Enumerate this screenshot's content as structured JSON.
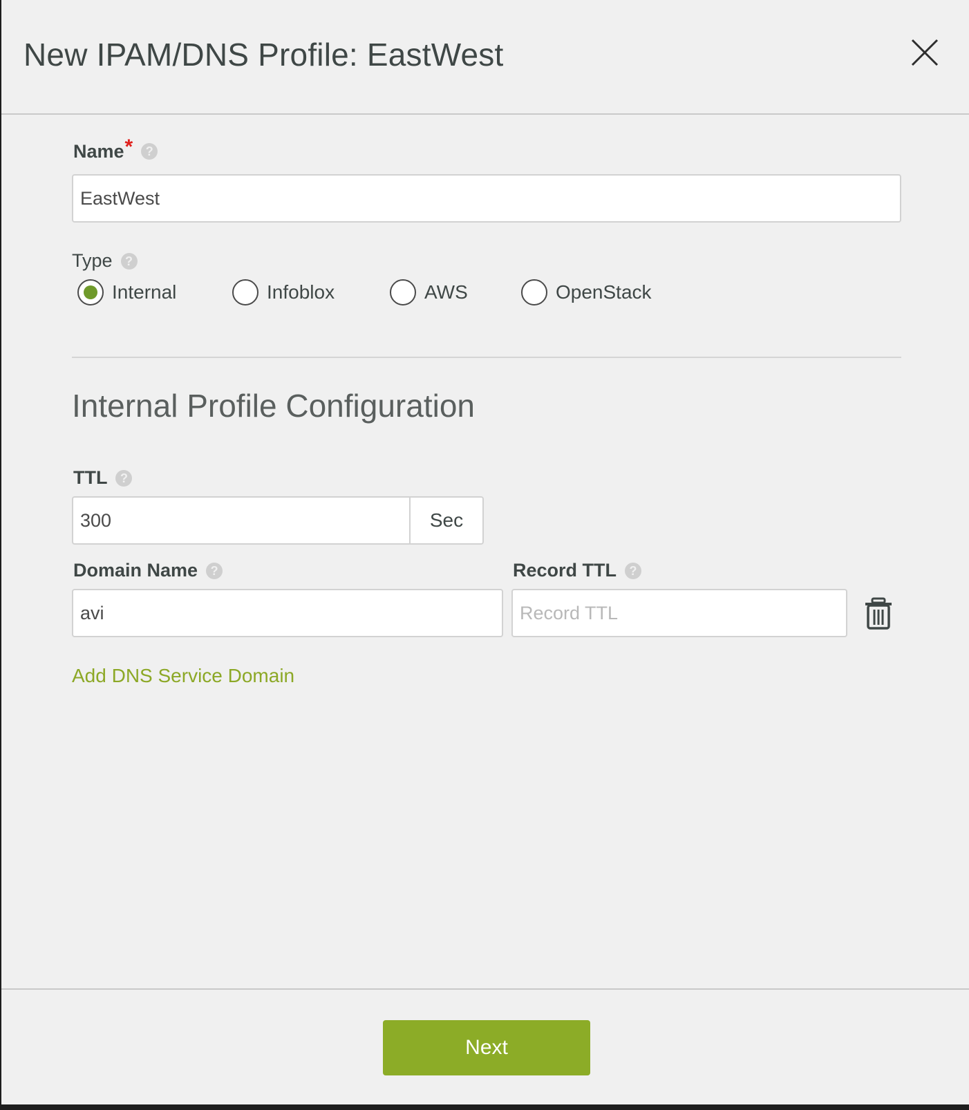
{
  "modal": {
    "title": "New IPAM/DNS Profile: EastWest"
  },
  "name_field": {
    "label": "Name",
    "required_mark": "*",
    "help": "?",
    "value": "EastWest"
  },
  "type_field": {
    "label": "Type",
    "help": "?",
    "options": [
      {
        "label": "Internal",
        "selected": true
      },
      {
        "label": "Infoblox",
        "selected": false
      },
      {
        "label": "AWS",
        "selected": false
      },
      {
        "label": "OpenStack",
        "selected": false
      }
    ]
  },
  "section": {
    "title": "Internal Profile Configuration"
  },
  "ttl_field": {
    "label": "TTL",
    "help": "?",
    "value": "300",
    "unit": "Sec"
  },
  "domain_row": {
    "domain_label": "Domain Name",
    "domain_help": "?",
    "domain_value": "avi",
    "record_ttl_label": "Record TTL",
    "record_ttl_help": "?",
    "record_ttl_placeholder": "Record TTL",
    "delete_icon": "trash-icon"
  },
  "add_link": "Add DNS Service Domain",
  "footer": {
    "next_label": "Next"
  },
  "colors": {
    "accent": "#8cac27",
    "link": "#8ca826",
    "required": "#e0201c",
    "radio_selected": "#6f9a2b"
  }
}
